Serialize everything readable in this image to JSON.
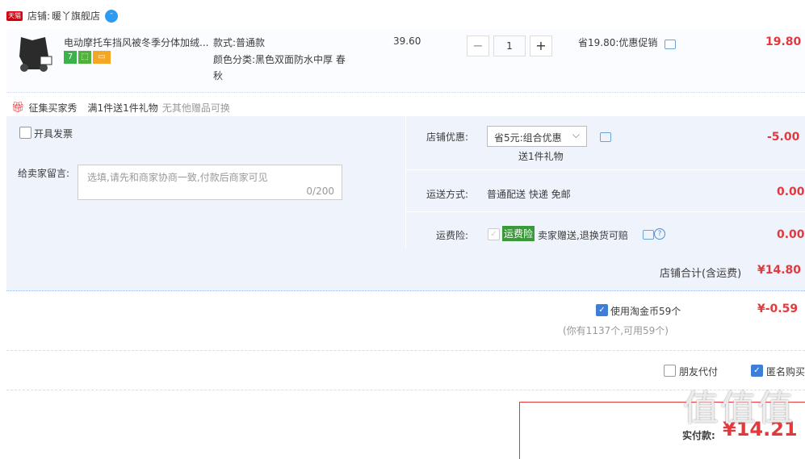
{
  "store": {
    "tmall_badge": "天猫",
    "label": "店铺:",
    "name": "暖丫旗舰店"
  },
  "item": {
    "title": "电动摩托车挡风被冬季分体加绒...",
    "spec_style": "款式:普通款",
    "spec_color": "颜色分类:黑色双面防水中厚 春",
    "spec_color_2": "秋",
    "badges": [
      "7",
      "",
      ""
    ],
    "unit_price": "39.60",
    "quantity": "1",
    "minus_label": "−",
    "plus_label": "+",
    "promo": "省19.80:优惠促销",
    "subtotal": "19.80"
  },
  "gift": {
    "title": "征集买家秀",
    "desc": "满1件送1件礼物",
    "note": "无其他赠品可换"
  },
  "invoice_label": "开具发票",
  "message": {
    "label": "给卖家留言:",
    "placeholder": "选填,请先和商家协商一致,付款后商家可见",
    "counter": "0/200"
  },
  "store_discount": {
    "label": "店铺优惠:",
    "selected": "省5元:组合优惠",
    "sub": "送1件礼物",
    "amount": "-5.00"
  },
  "shipping": {
    "label": "运送方式:",
    "value": "普通配送 快递 免邮",
    "amount": "0.00"
  },
  "insurance": {
    "label": "运费险:",
    "tag": "运费险",
    "desc": "卖家赠送,退换货可赔",
    "amount": "0.00"
  },
  "store_total": {
    "label": "店铺合计(含运费)",
    "amount": "¥14.80"
  },
  "coins": {
    "label": "使用淘金币59个",
    "sub": "(你有1137个,可用59个)",
    "amount": "¥-0.59"
  },
  "options": {
    "friend_pay": "朋友代付",
    "anonymous": "匿名购买"
  },
  "payable": {
    "label": "实付款:",
    "amount": "¥14.21"
  },
  "watermark": "值值值",
  "colors": {
    "accent_red": "#e4393c",
    "panel_bg": "#eef3fc",
    "check_blue": "#3d7fd8"
  }
}
